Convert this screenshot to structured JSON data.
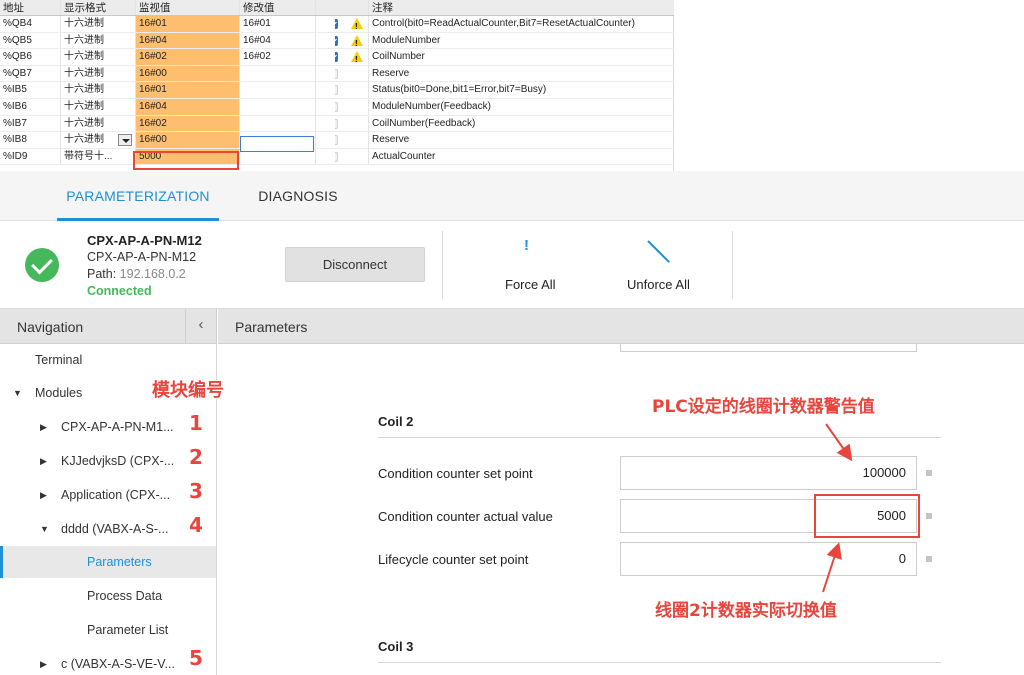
{
  "watch_table": {
    "headers": {
      "address": "地址",
      "format": "显示格式",
      "monitor": "监视值",
      "modify": "修改值",
      "comment": "注释"
    },
    "rows": [
      {
        "address": "%QB4",
        "format": "十六进制",
        "monitor": "16#01",
        "modify": "16#01",
        "checked": true,
        "warn": true,
        "comment": "Control(bit0=ReadActualCounter,Bit7=ResetActualCounter)"
      },
      {
        "address": "%QB5",
        "format": "十六进制",
        "monitor": "16#04",
        "modify": "16#04",
        "checked": true,
        "warn": true,
        "comment": "ModuleNumber"
      },
      {
        "address": "%QB6",
        "format": "十六进制",
        "monitor": "16#02",
        "modify": "16#02",
        "checked": true,
        "warn": true,
        "comment": "CoilNumber"
      },
      {
        "address": "%QB7",
        "format": "十六进制",
        "monitor": "16#00",
        "modify": "",
        "checked": false,
        "warn": false,
        "comment": "Reserve"
      },
      {
        "address": "%IB5",
        "format": "十六进制",
        "monitor": "16#01",
        "modify": "",
        "checked": false,
        "warn": false,
        "comment": "Status(bit0=Done,bit1=Error,bit7=Busy)"
      },
      {
        "address": "%IB6",
        "format": "十六进制",
        "monitor": "16#04",
        "modify": "",
        "checked": false,
        "warn": false,
        "comment": "ModuleNumber(Feedback)"
      },
      {
        "address": "%IB7",
        "format": "十六进制",
        "monitor": "16#02",
        "modify": "",
        "checked": false,
        "warn": false,
        "comment": "CoilNumber(Feedback)"
      },
      {
        "address": "%IB8",
        "format": "十六进制",
        "monitor": "16#00",
        "modify": "",
        "checked": false,
        "warn": false,
        "comment": "Reserve"
      },
      {
        "address": "%ID9",
        "format": "带符号十...",
        "monitor": "5000",
        "modify": "",
        "checked": false,
        "warn": false,
        "comment": "ActualCounter"
      }
    ]
  },
  "tabs": [
    {
      "label": "PARAMETERIZATION"
    },
    {
      "label": "DIAGNOSIS"
    }
  ],
  "device": {
    "title": "CPX-AP-A-PN-M12",
    "subtitle": "CPX-AP-A-PN-M12",
    "path_label": "Path:",
    "path_value": "192.168.0.2",
    "status": "Connected",
    "disconnect_label": "Disconnect",
    "force_all": "Force All",
    "unforce_all": "Unforce All"
  },
  "navigation": {
    "title": "Navigation",
    "collapse_glyph": "‹",
    "items": [
      {
        "label": "Terminal"
      },
      {
        "label": "Modules"
      },
      {
        "label": "CPX-AP-A-PN-M1..."
      },
      {
        "label": "KJJedvjksD (CPX-..."
      },
      {
        "label": "Application (CPX-..."
      },
      {
        "label": "dddd (VABX-A-S-..."
      },
      {
        "label": "Parameters"
      },
      {
        "label": "Process Data"
      },
      {
        "label": "Parameter List"
      },
      {
        "label": "c (VABX-A-S-VE-V..."
      }
    ]
  },
  "parameters": {
    "title": "Parameters",
    "coil2_header": "Coil  2",
    "coil3_header": "Coil  3",
    "fields": [
      {
        "label": "Condition counter set point",
        "value": "100000"
      },
      {
        "label": "Condition counter actual value",
        "value": "5000"
      },
      {
        "label": "Lifecycle counter set point",
        "value": "0"
      }
    ]
  },
  "annotations": {
    "module_number": "模块编号",
    "numbers": [
      "1",
      "2",
      "3",
      "4",
      "5"
    ],
    "plc_warning": "PLC设定的线圈计数器警告值",
    "coil2_actual": "线圈2计数器实际切换值",
    "accent_color": "#e8453c"
  }
}
